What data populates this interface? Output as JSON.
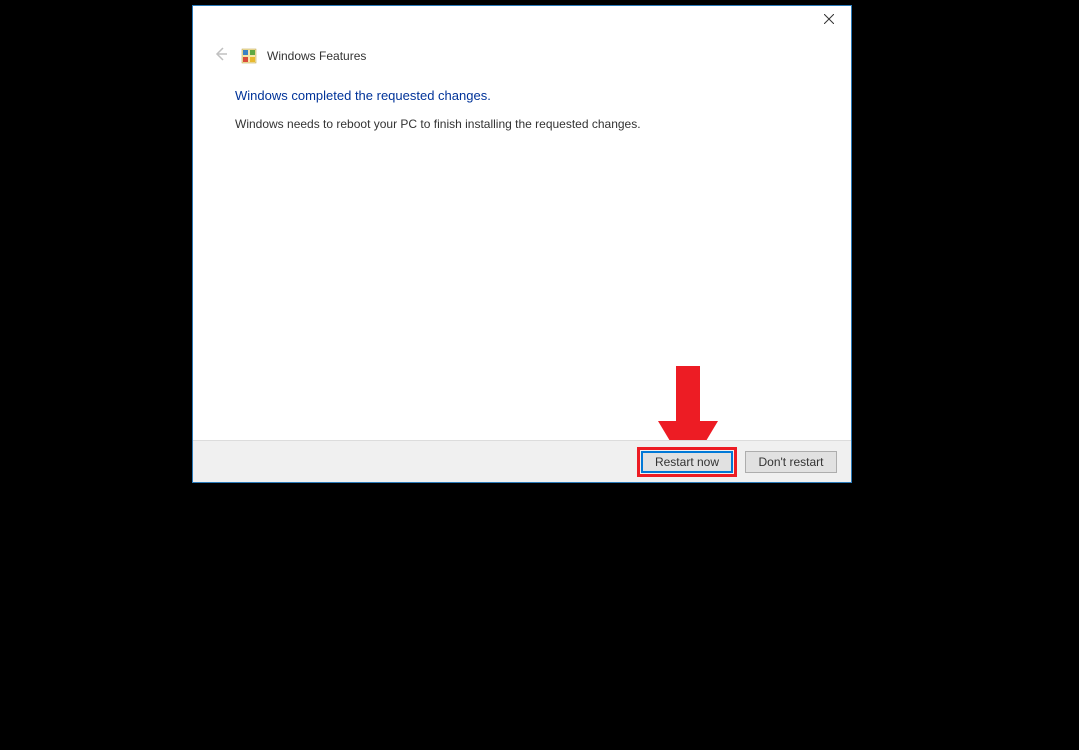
{
  "header": {
    "title": "Windows Features"
  },
  "content": {
    "heading": "Windows completed the requested changes.",
    "subtext": "Windows needs to reboot your PC to finish installing the requested changes."
  },
  "footer": {
    "restart_label": "Restart now",
    "dont_restart_label": "Don't restart"
  }
}
